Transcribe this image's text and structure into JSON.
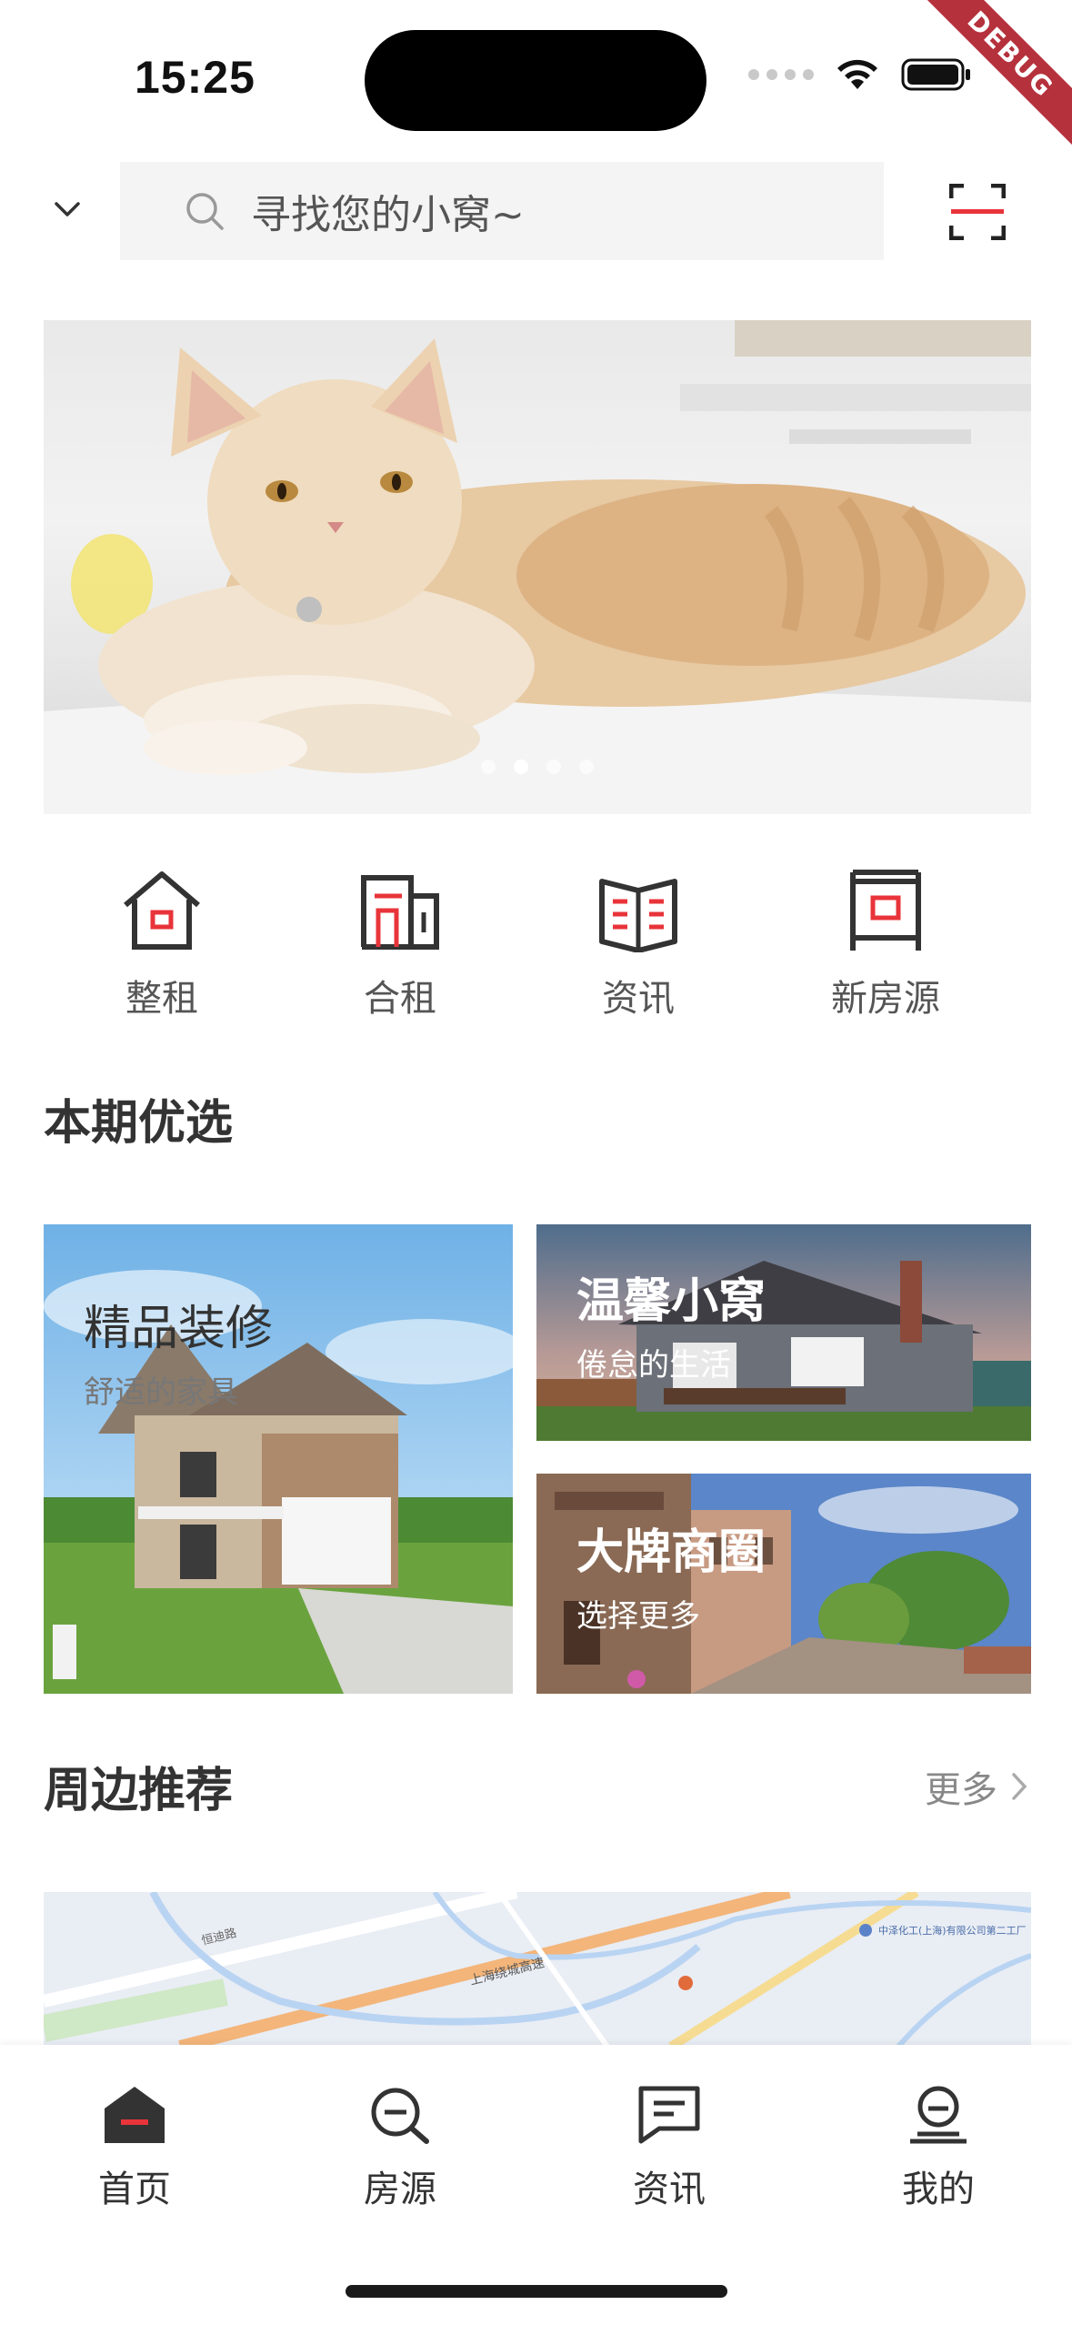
{
  "status_bar": {
    "time": "15:25",
    "debug_label": "DEBUG"
  },
  "search": {
    "placeholder": "寻找您的小窝~"
  },
  "banner": {
    "dot_count": 4,
    "active_dot": 1
  },
  "quick_nav": [
    {
      "label": "整租",
      "icon": "house-icon"
    },
    {
      "label": "合租",
      "icon": "building-icon"
    },
    {
      "label": "资讯",
      "icon": "book-icon"
    },
    {
      "label": "新房源",
      "icon": "signboard-icon"
    }
  ],
  "featured": {
    "title": "本期优选",
    "tiles": [
      {
        "title": "精品装修",
        "subtitle": "舒适的家具"
      },
      {
        "title": "温馨小窝",
        "subtitle": "倦怠的生活"
      },
      {
        "title": "大牌商圈",
        "subtitle": "选择更多"
      }
    ]
  },
  "nearby": {
    "title": "周边推荐",
    "more_label": "更多",
    "map_labels": [
      "上海绕城高速",
      "恒迪路",
      "中泽化工(上海)有限公司第二工厂"
    ]
  },
  "tabbar": [
    {
      "label": "首页",
      "icon": "home-icon",
      "active": true
    },
    {
      "label": "房源",
      "icon": "search-house-icon",
      "active": false
    },
    {
      "label": "资讯",
      "icon": "message-icon",
      "active": false
    },
    {
      "label": "我的",
      "icon": "profile-icon",
      "active": false
    }
  ],
  "colors": {
    "accent": "#e8343a",
    "icon": "#333333"
  }
}
